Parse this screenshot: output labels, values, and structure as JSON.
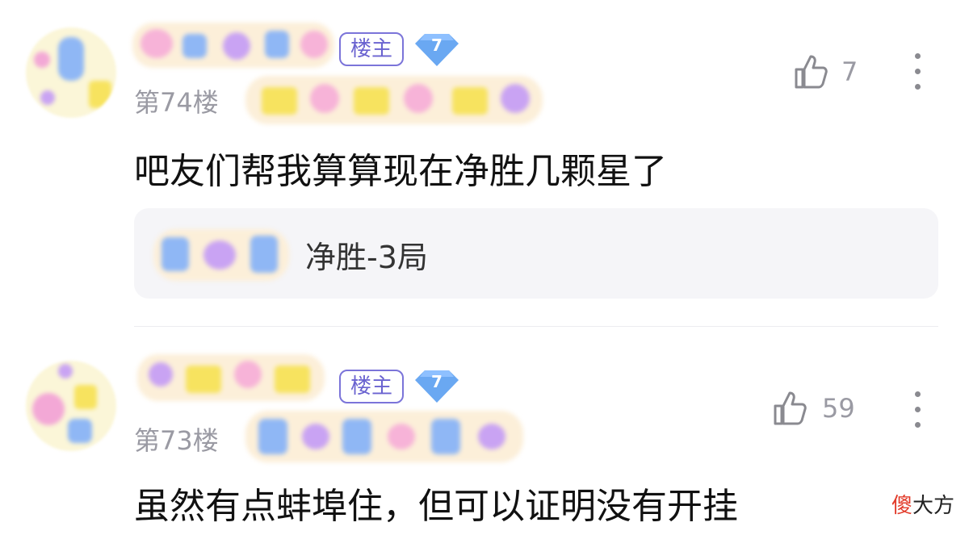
{
  "comments": [
    {
      "owner_badge": "楼主",
      "level": "7",
      "floor": "第74楼",
      "likes": "7",
      "content": "吧友们帮我算算现在净胜几颗星了",
      "quote_text": "净胜-3局"
    },
    {
      "owner_badge": "楼主",
      "level": "7",
      "floor": "第73楼",
      "likes": "59",
      "content": "虽然有点蚌埠住，但可以证明没有开挂"
    }
  ],
  "watermark": {
    "first": "傻",
    "rest": "大方"
  },
  "colors": {
    "badge_border": "#7b74d9",
    "badge_level": "#6aa8f2",
    "muted": "#9a9aa3"
  }
}
